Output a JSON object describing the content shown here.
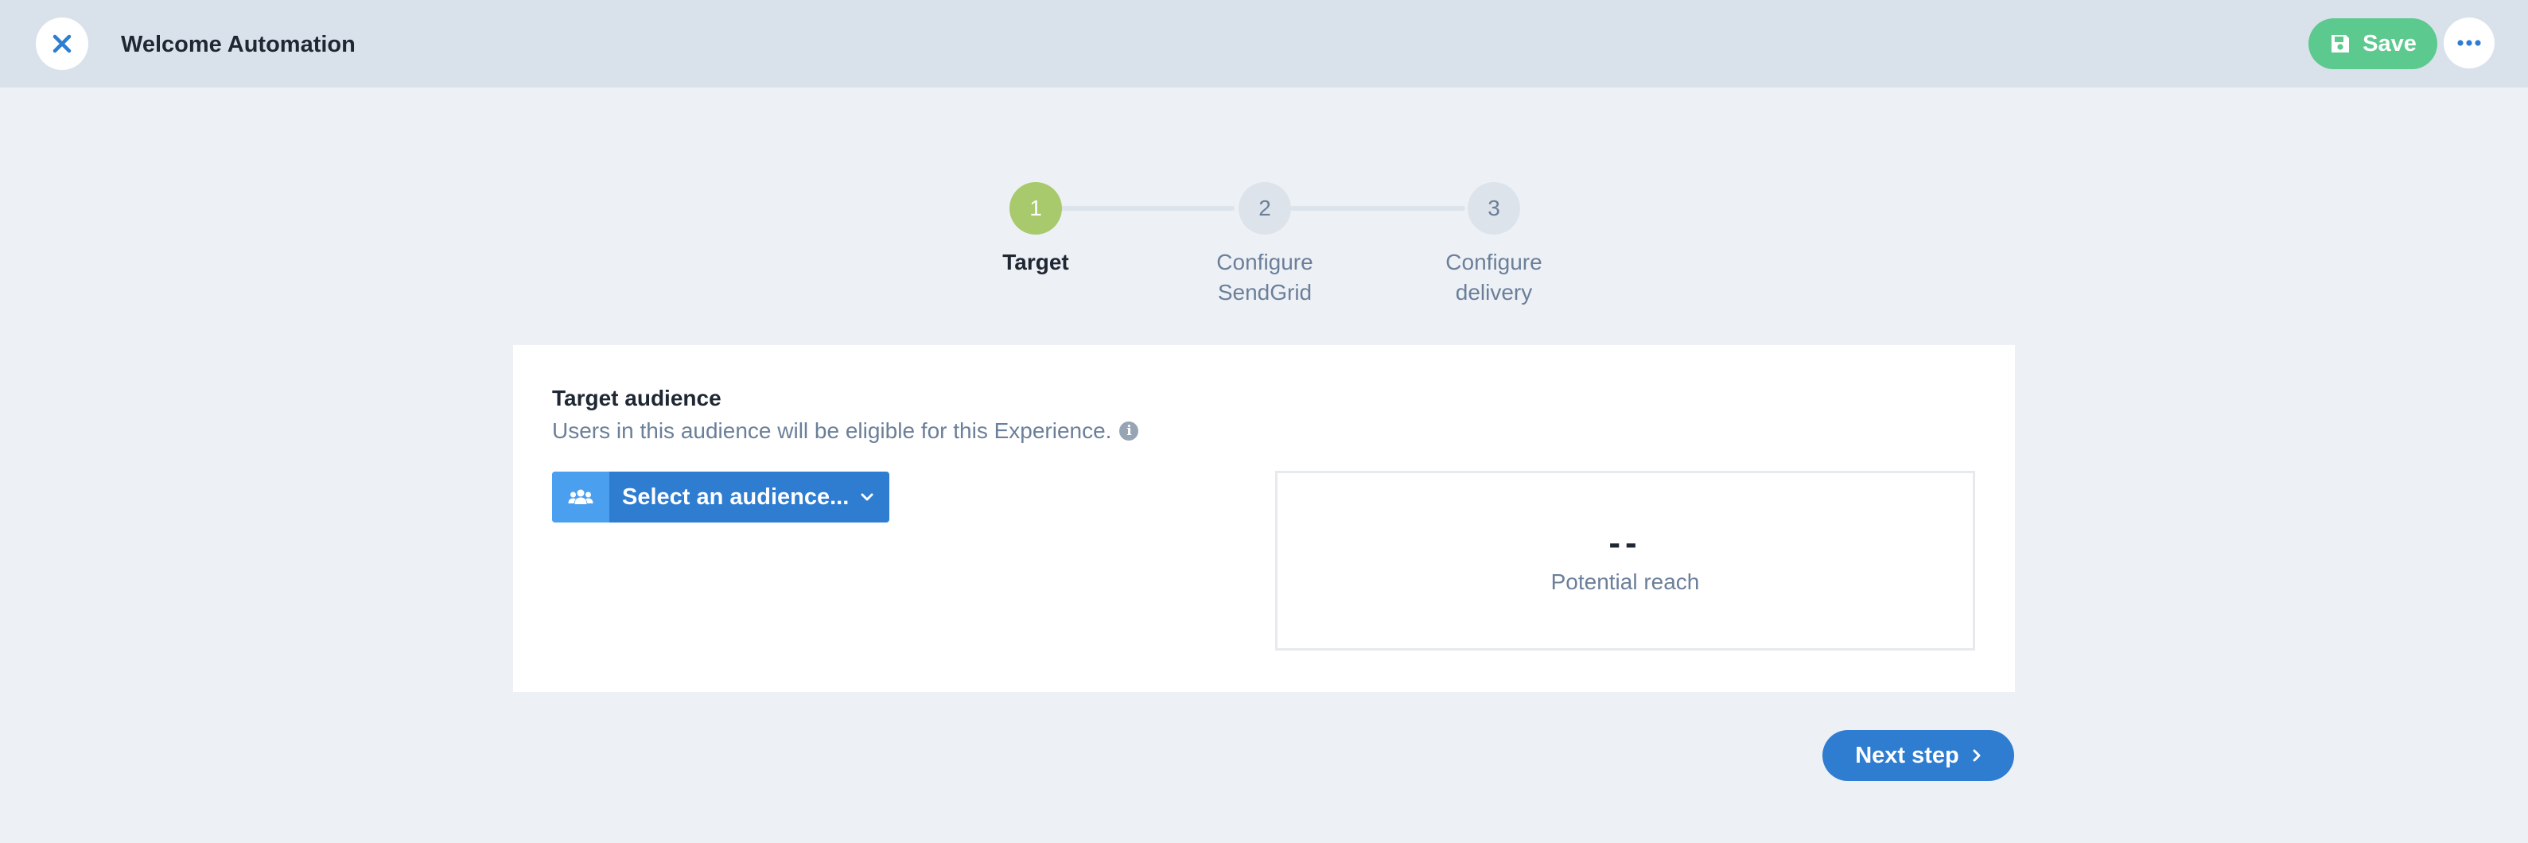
{
  "header": {
    "title": "Welcome Automation",
    "save_label": "Save",
    "close_icon": "close-icon",
    "save_icon": "floppy-disk-icon",
    "more_icon": "ellipsis-icon"
  },
  "stepper": {
    "steps": [
      {
        "number": "1",
        "line1": "Target",
        "line2": "",
        "state": "active"
      },
      {
        "number": "2",
        "line1": "Configure",
        "line2": "SendGrid",
        "state": "pending"
      },
      {
        "number": "3",
        "line1": "Configure",
        "line2": "delivery",
        "state": "pending"
      }
    ]
  },
  "target": {
    "title": "Target audience",
    "description": "Users in this audience will be eligible for this Experience.",
    "info_icon": "info-icon",
    "select_label": "Select an audience...",
    "select_icon": "users-icon",
    "reach_value": "--",
    "reach_label": "Potential reach"
  },
  "footer": {
    "next_label": "Next step",
    "next_icon": "chevron-right-icon"
  },
  "colors": {
    "header_bg": "#d9e1eb",
    "page_bg": "#edf1f6",
    "save_green": "#5cc98e",
    "step_active": "#a8c96c",
    "primary_blue": "#2e7dd1",
    "icon_blue": "#4aa0ef"
  }
}
